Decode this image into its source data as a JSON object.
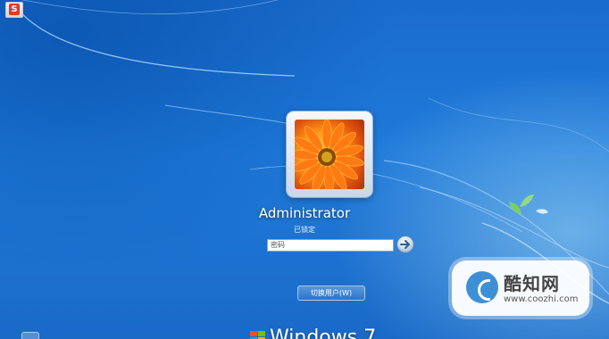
{
  "app_icon": {
    "glyph": "S",
    "icon": "wps-app-icon"
  },
  "user": {
    "name": "Administrator",
    "status": "已锁定"
  },
  "password": {
    "value": "密码"
  },
  "buttons": {
    "switch_user": "切换用户(W)",
    "submit_icon": "arrow-right-icon"
  },
  "branding": {
    "os_text": "Windows 7"
  },
  "watermark": {
    "text": "酷知网",
    "url": "www.coozhi.com"
  },
  "colors": {
    "desktop": "#1f7ad9",
    "swirl": "#b6e0ff",
    "accent_orange": "#ff9a18"
  }
}
